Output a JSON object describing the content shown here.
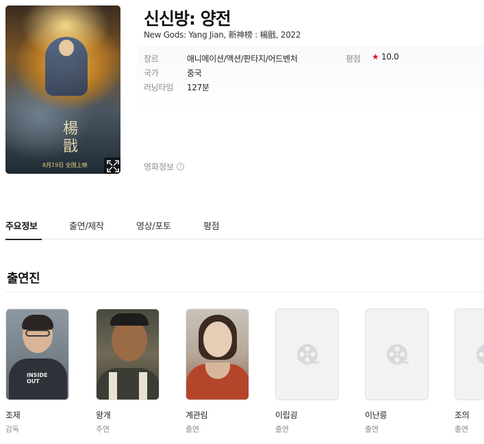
{
  "movie": {
    "title": "신신방: 양전",
    "subtitle": "New Gods: Yang Jian, 新神榜 : 楊戩, 2022",
    "poster_text": "楊戩",
    "poster_date": "8月19日 全国上映",
    "genre_label": "장르",
    "genre_value": "애니메이션/액션/판타지/어드벤처",
    "country_label": "국가",
    "country_value": "중국",
    "runtime_label": "러닝타임",
    "runtime_value": "127분",
    "rating_label": "평점",
    "rating_star": "★",
    "rating_value": "10.0",
    "info_link": "영화정보",
    "info_icon": "!"
  },
  "tabs": [
    {
      "label": "주요정보",
      "active": true
    },
    {
      "label": "출연/제작",
      "active": false
    },
    {
      "label": "영상/포토",
      "active": false
    },
    {
      "label": "평점",
      "active": false
    }
  ],
  "cast_section": {
    "title": "출연진",
    "members": [
      {
        "name": "조제",
        "role": "감독",
        "photo": "person"
      },
      {
        "name": "왕개",
        "role": "주연",
        "photo": "person"
      },
      {
        "name": "계관림",
        "role": "출연",
        "photo": "person"
      },
      {
        "name": "이립굉",
        "role": "출연",
        "photo": "film-reel-icon"
      },
      {
        "name": "이난릉",
        "role": "출연",
        "photo": "film-reel-icon"
      },
      {
        "name": "조의",
        "role": "출연",
        "photo": "film-reel-icon"
      }
    ]
  },
  "colors": {
    "rating_star": "#e0112b",
    "muted_text": "#8a8a8a",
    "tab_underline": "#222222"
  }
}
